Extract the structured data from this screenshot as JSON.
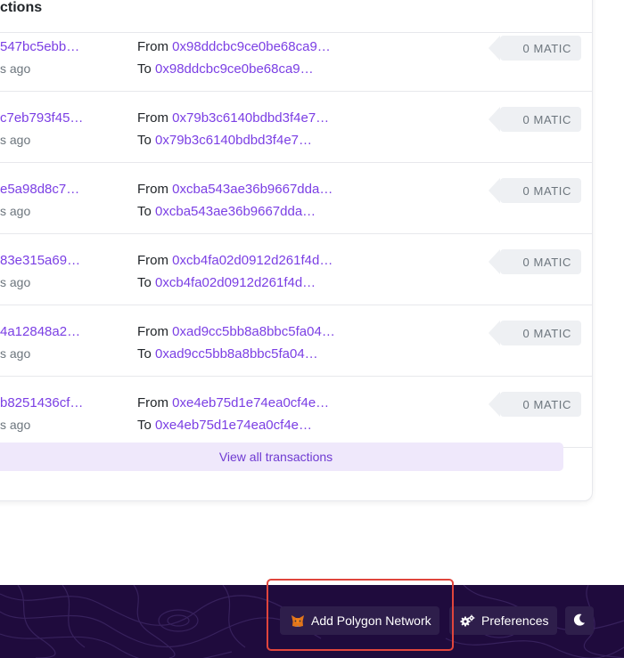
{
  "card": {
    "title": "ctions",
    "from_label": "From",
    "to_label": "To",
    "transactions": [
      {
        "hash": "547bc5ebb…",
        "age": "s ago",
        "from": "0x98ddcbc9ce0be68ca9…",
        "to": "0x98ddcbc9ce0be68ca9…",
        "amount": "0 MATIC"
      },
      {
        "hash": "c7eb793f45…",
        "age": "s ago",
        "from": "0x79b3c6140bdbd3f4e7…",
        "to": "0x79b3c6140bdbd3f4e7…",
        "amount": "0 MATIC"
      },
      {
        "hash": "e5a98d8c7…",
        "age": "s ago",
        "from": "0xcba543ae36b9667dda…",
        "to": "0xcba543ae36b9667dda…",
        "amount": "0 MATIC"
      },
      {
        "hash": "83e315a69…",
        "age": "s ago",
        "from": "0xcb4fa02d0912d261f4d…",
        "to": "0xcb4fa02d0912d261f4d…",
        "amount": "0 MATIC"
      },
      {
        "hash": "4a12848a2…",
        "age": "s ago",
        "from": "0xad9cc5bb8a8bbc5fa04…",
        "to": "0xad9cc5bb8a8bbc5fa04…",
        "amount": "0 MATIC"
      },
      {
        "hash": "b8251436cf…",
        "age": "s ago",
        "from": "0xe4eb75d1e74ea0cf4e…",
        "to": "0xe4eb75d1e74ea0cf4e…",
        "amount": "0 MATIC"
      }
    ],
    "view_all_label": "View all transactions"
  },
  "footer": {
    "add_network_label": "Add Polygon Network",
    "add_network_icon": "metamask-fox-icon",
    "preferences_label": "Preferences",
    "preferences_icon": "gears-icon",
    "theme_icon": "moon-icon"
  },
  "colors": {
    "accent": "#7b3fe4",
    "footer_bg": "#1f0b3d",
    "highlight": "#e0453c"
  }
}
